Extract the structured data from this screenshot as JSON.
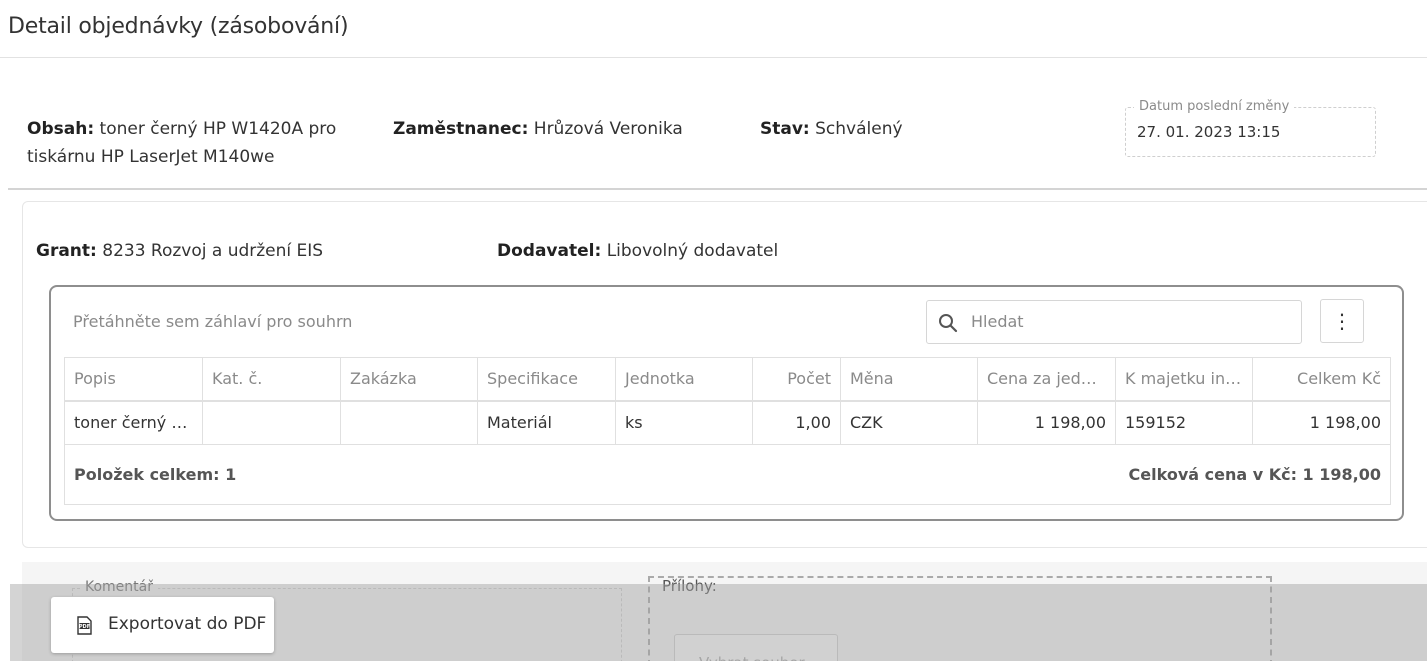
{
  "page": {
    "title": "Detail objednávky (zásobování)"
  },
  "info": {
    "obsah_label": "Obsah:",
    "obsah_value": "toner černý HP W1420A pro tiskárnu HP LaserJet M140we",
    "zamestnanec_label": "Zaměstnanec:",
    "zamestnanec_value": "Hrůzová Veronika",
    "stav_label": "Stav:",
    "stav_value": "Schválený",
    "datum_legend": "Datum poslední změny",
    "datum_value": "27. 01. 2023 13:15"
  },
  "grant": {
    "grant_label": "Grant:",
    "grant_value": "8233 Rozvoj a udržení EIS",
    "dodavatel_label": "Dodavatel:",
    "dodavatel_value": "Libovolný dodavatel"
  },
  "grid": {
    "group_hint": "Přetáhněte sem záhlaví pro souhrn",
    "search_placeholder": "Hledat",
    "menu_glyph": "⋮",
    "columns": [
      "Popis",
      "Kat. č.",
      "Zakázka",
      "Specifikace",
      "Jednotka",
      "Počet",
      "Měna",
      "Cena za jedn...",
      "K majetku inv...",
      "Celkem Kč"
    ],
    "rows": [
      [
        "toner černý H...",
        "",
        "",
        "Materiál",
        "ks",
        "1,00",
        "CZK",
        "1 198,00",
        "159152",
        "1 198,00"
      ]
    ],
    "footer_count": "Položek celkem: 1",
    "footer_total": "Celková cena v Kč: 1 198,00"
  },
  "bottom": {
    "comment_legend": "Komentář",
    "attach_legend": "Přílohy:",
    "choose_file": "Vybrat soubor"
  },
  "export": {
    "label": "Exportovat do PDF",
    "icon": "pdf-icon"
  }
}
